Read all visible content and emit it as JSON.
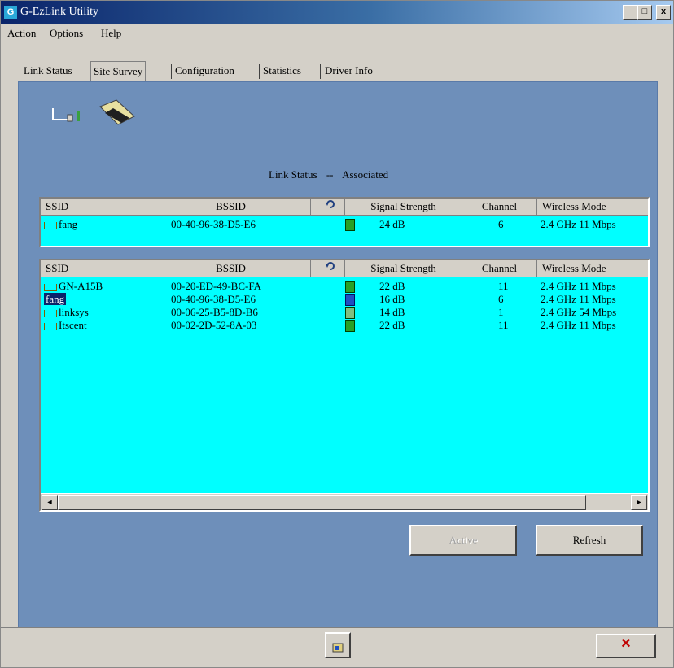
{
  "window": {
    "title": "G-EzLink Utility",
    "app_icon": "G",
    "minimize": "_",
    "maximize": "□",
    "close": "x"
  },
  "menu": [
    "Action",
    "Options",
    "Help"
  ],
  "tabs": [
    "Link Status",
    "Site Survey",
    "Configuration",
    "Statistics",
    "Driver Info"
  ],
  "active_tab": "Site Survey",
  "status": {
    "label": "Link Status",
    "separator": "--",
    "value": "Associated"
  },
  "columns": [
    "SSID",
    "BSSID",
    "",
    "Signal Strength",
    "Channel",
    "Wireless Mode"
  ],
  "connected": [
    {
      "ssid": "fang",
      "bssid": "00-40-96-38-D5-E6",
      "signal": "24 dB",
      "channel": "6",
      "mode": "2.4 GHz 11 Mbps"
    }
  ],
  "networks": [
    {
      "ssid": "GN-A15B",
      "bssid": "00-20-ED-49-BC-FA",
      "signal": "22 dB",
      "channel": "11",
      "mode": "2.4 GHz 11 Mbps",
      "selected": false
    },
    {
      "ssid": "fang",
      "bssid": "00-40-96-38-D5-E6",
      "signal": "16 dB",
      "channel": "6",
      "mode": "2.4 GHz 11 Mbps",
      "selected": true
    },
    {
      "ssid": "linksys",
      "bssid": "00-06-25-B5-8D-B6",
      "signal": "14 dB",
      "channel": "1",
      "mode": "2.4 GHz 54 Mbps",
      "selected": false
    },
    {
      "ssid": "Itscent",
      "bssid": "00-02-2D-52-8A-03",
      "signal": "22 dB",
      "channel": "11",
      "mode": "2.4 GHz 11 Mbps",
      "selected": false
    }
  ],
  "buttons": {
    "active": "Active",
    "refresh": "Refresh"
  },
  "scroll": {
    "left": "◄",
    "right": "►"
  },
  "bottom": {
    "close": "✕"
  },
  "colors": {
    "panel": "#6e8fba",
    "grid": "#00ffff",
    "title_start": "#0a246a",
    "close_x": "#c00000"
  },
  "icons": {
    "header_icon": "refresh-icon",
    "network": "ap-network-icon",
    "card": "wireless-card-icon",
    "bottom_left": "hide-icon"
  }
}
